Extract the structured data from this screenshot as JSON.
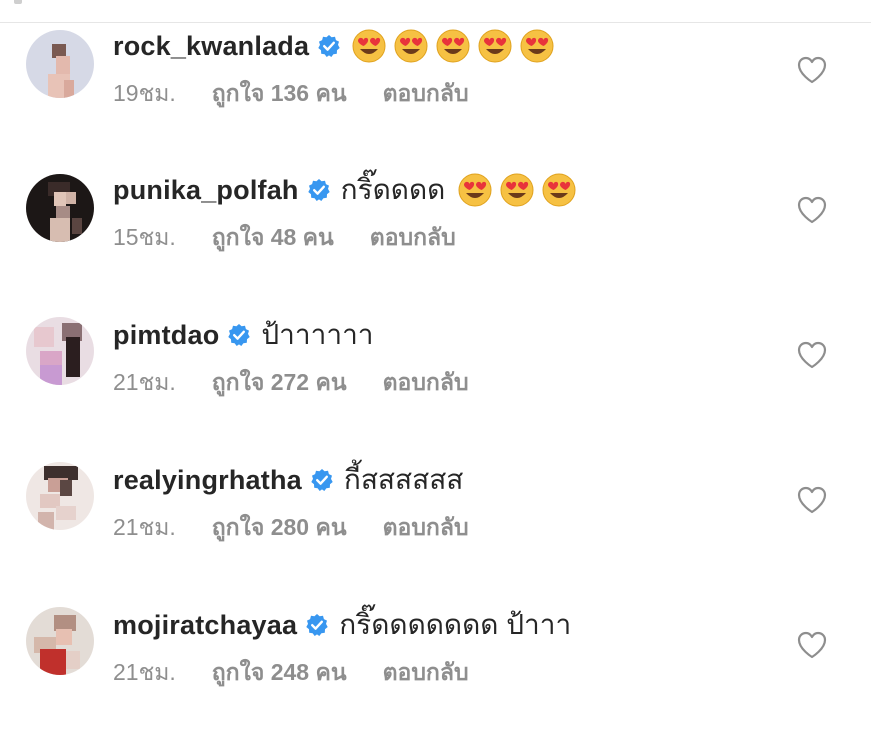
{
  "comments": [
    {
      "username": "rock_kwanlada",
      "verified": true,
      "text": "",
      "emojis": [
        "heart-eyes",
        "heart-eyes",
        "heart-eyes",
        "heart-eyes",
        "heart-eyes"
      ],
      "time": "19ชม.",
      "likes": "ถูกใจ 136 คน",
      "reply": "ตอบกลับ",
      "liked": false
    },
    {
      "username": "punika_polfah",
      "verified": true,
      "text": "กริ๊ดดดด",
      "emojis": [
        "heart-eyes",
        "heart-eyes",
        "heart-eyes"
      ],
      "time": "15ชม.",
      "likes": "ถูกใจ 48 คน",
      "reply": "ตอบกลับ",
      "liked": false
    },
    {
      "username": "pimtdao",
      "verified": true,
      "text": "ป้าาาาาา",
      "emojis": [],
      "time": "21ชม.",
      "likes": "ถูกใจ 272 คน",
      "reply": "ตอบกลับ",
      "liked": false
    },
    {
      "username": "realyingrhatha",
      "verified": true,
      "text": "กี้สสสสสส",
      "emojis": [],
      "time": "21ชม.",
      "likes": "ถูกใจ 280 คน",
      "reply": "ตอบกลับ",
      "liked": false
    },
    {
      "username": "mojiratchayaa",
      "verified": true,
      "text": "กริ๊ดดดดดดด ป้าาา",
      "emojis": [],
      "time": "21ชม.",
      "likes": "ถูกใจ 248 คน",
      "reply": "ตอบกลับ",
      "liked": false
    }
  ],
  "icons": {
    "verified": "verified-badge-icon",
    "heart": "heart-outline-icon",
    "emoji": "heart-eyes-emoji"
  },
  "colors": {
    "username": "#262626",
    "meta": "#8e8e8e",
    "verified": "#3897f0",
    "heart_outline": "#8e8e8e"
  }
}
